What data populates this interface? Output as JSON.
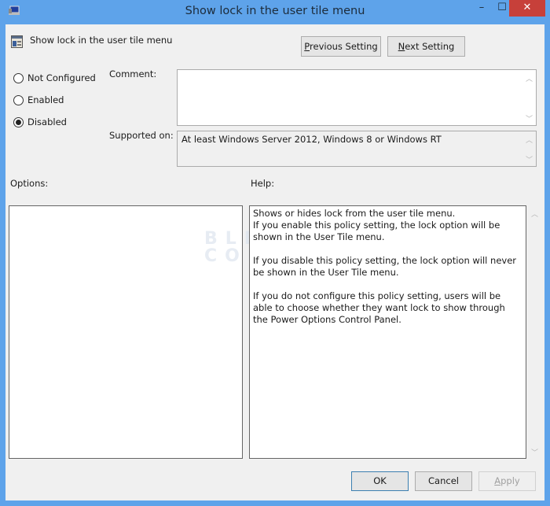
{
  "window": {
    "title": "Show lock in the user tile menu",
    "controls": {
      "minimize": "–",
      "maximize": "☐",
      "close": "✕"
    },
    "accent_color": "#5ea3ea",
    "close_color": "#c7403a"
  },
  "header": {
    "setting_name": "Show lock in the user tile menu",
    "previous_label": "Previous Setting",
    "next_label": "Next Setting"
  },
  "state": {
    "options": [
      {
        "label": "Not Configured",
        "checked": false
      },
      {
        "label": "Enabled",
        "checked": false
      },
      {
        "label": "Disabled",
        "checked": true
      }
    ]
  },
  "comment": {
    "label": "Comment:",
    "value": ""
  },
  "supported": {
    "label": "Supported on:",
    "value": "At least Windows Server 2012, Windows 8 or Windows RT"
  },
  "options_label": "Options:",
  "help": {
    "label": "Help:",
    "text": "Shows or hides lock from the user tile menu.\nIf you enable this policy setting, the lock option will be shown in the User Tile menu.\n\nIf you disable this policy setting, the lock option will never be shown in the User Tile menu.\n\nIf you do not configure this policy setting, users will be able to choose whether they want lock to show through the Power Options Control Panel."
  },
  "footer": {
    "ok_label": "OK",
    "cancel_label": "Cancel",
    "apply_label": "Apply"
  },
  "watermark": {
    "line1": "BLEEPING",
    "line2": "COMPUTER"
  }
}
